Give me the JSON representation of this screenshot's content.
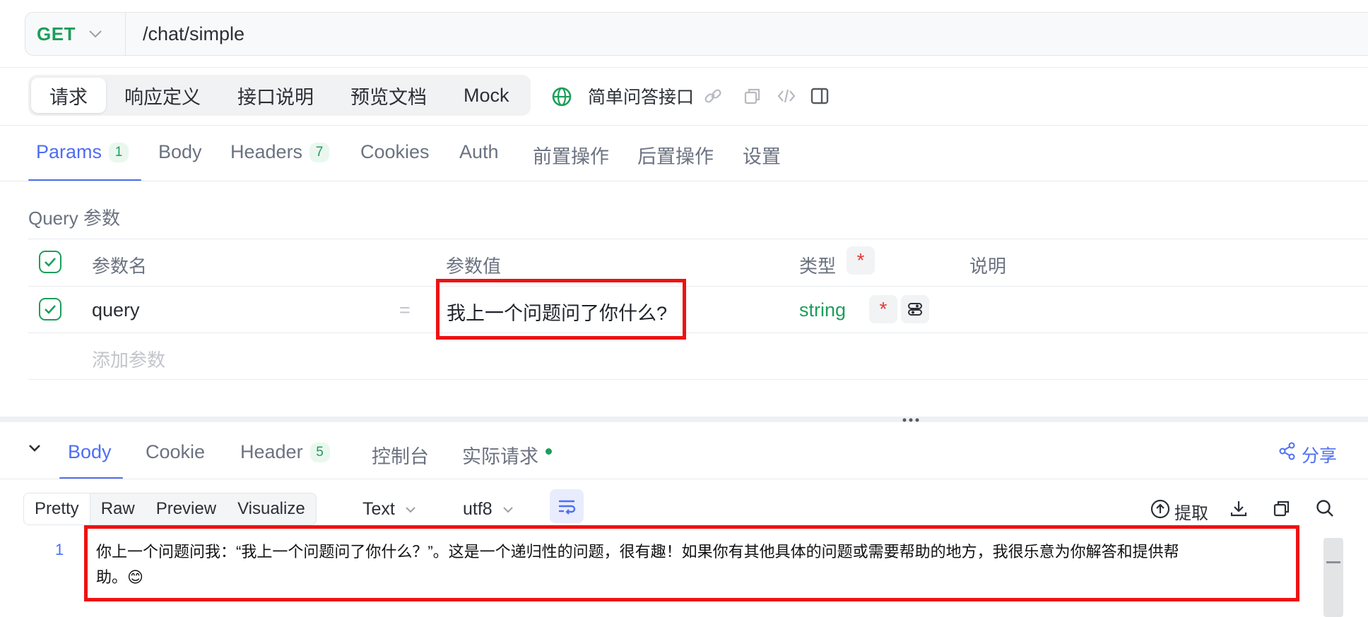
{
  "request": {
    "method": "GET",
    "url": "/chat/simple"
  },
  "segment_tabs": [
    "请求",
    "响应定义",
    "接口说明",
    "预览文档",
    "Mock"
  ],
  "api_name": "简单问答接口",
  "param_tabs": {
    "params": {
      "label": "Params",
      "count": "1"
    },
    "body": "Body",
    "headers": {
      "label": "Headers",
      "count": "7"
    },
    "cookies": "Cookies",
    "auth": "Auth",
    "pre": "前置操作",
    "post": "后置操作",
    "settings": "设置"
  },
  "query_section": "Query 参数",
  "table": {
    "headers": {
      "name": "参数名",
      "value": "参数值",
      "type": "类型",
      "required_mark": "*",
      "desc": "说明"
    },
    "row": {
      "name": "query",
      "eq": "=",
      "value": "我上一个问题问了你什么?",
      "type": "string",
      "required_mark": "*"
    },
    "add_placeholder": "添加参数"
  },
  "response_tabs": {
    "body": "Body",
    "cookie": "Cookie",
    "header": {
      "label": "Header",
      "count": "5"
    },
    "console": "控制台",
    "actual": "实际请求"
  },
  "share": "分享",
  "format_tabs": [
    "Pretty",
    "Raw",
    "Preview",
    "Visualize"
  ],
  "content_type": "Text",
  "encoding": "utf8",
  "extract": "提取",
  "response_body": {
    "line": "1",
    "text_line1": "你上一个问题问我：“我上一个问题问了你什么？”。这是一个递归性的问题，很有趣！如果你有其他具体的问题或需要帮助的地方，我很乐意为你解答和提供帮",
    "text_line2": "助。😊"
  },
  "colors": {
    "accent": "#4e6ef2",
    "method_green": "#1b9e5a",
    "highlight_red": "#ee1111",
    "required_red": "#e53935"
  }
}
